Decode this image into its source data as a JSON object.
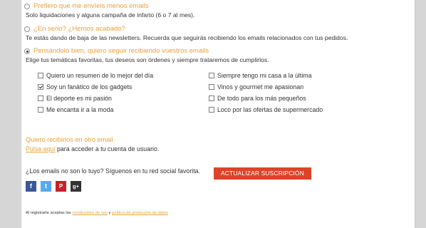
{
  "options": [
    {
      "title": "Prefiero que me envíeis menos emails",
      "desc": "Solo liquidaciones y alguna campaña de infarto (6 o 7 al mes).",
      "selected": false
    },
    {
      "title": "¿En serio? ¿Hemos acabado?",
      "desc": "Te estás dando de baja de las newsletters. Recuerda que seguirás recibiendo los emails relacionados con tus pedidos.",
      "selected": false
    },
    {
      "title": "Pensándolo bien, quiero seguir recibiendo vuestros emails",
      "desc": "Elige tus temáticas favoritas, tus deseos son órdenes y siempre trataremos de cumplirlos.",
      "selected": true
    }
  ],
  "topics": {
    "left": [
      {
        "label": "Quiero un resumen de lo mejor del día",
        "checked": false
      },
      {
        "label": "Soy un fanático de los gadgets",
        "checked": true
      },
      {
        "label": "El deporte es mi pasión",
        "checked": false
      },
      {
        "label": "Me encanta ir a la moda",
        "checked": false
      }
    ],
    "right": [
      {
        "label": "Siempre tengo mi casa a la última",
        "checked": false
      },
      {
        "label": "Vinos y gourmet me apasionan",
        "checked": false
      },
      {
        "label": "De todo para los más pequeños",
        "checked": false
      },
      {
        "label": "Loco por las ofertas de supermercado",
        "checked": false
      }
    ]
  },
  "other_email": {
    "title": "Quiero recibirlos en otro email",
    "link": "Pulsa aquí",
    "text": " para acceder a tu cuenta de usuario."
  },
  "social": {
    "text": "¿Los emails no son lo tuyo? Síguenos en tu red social favorita.",
    "icons": [
      {
        "name": "facebook-icon",
        "glyph": "f",
        "color": "#3b5998"
      },
      {
        "name": "twitter-icon",
        "glyph": "t",
        "color": "#55acee"
      },
      {
        "name": "pinterest-icon",
        "glyph": "P",
        "color": "#cb2027"
      },
      {
        "name": "googleplus-icon",
        "glyph": "g+",
        "color": "#333333"
      }
    ]
  },
  "update_button": "ACTUALIZAR SUSCRIPCIÓN",
  "legal": {
    "prefix": "Al registrarte aceptas las ",
    "terms": "condiciones de uso",
    "middle": " y ",
    "privacy": "política de protección de datos"
  },
  "colors": {
    "accent": "#e8a13a",
    "button": "#dd4328"
  }
}
